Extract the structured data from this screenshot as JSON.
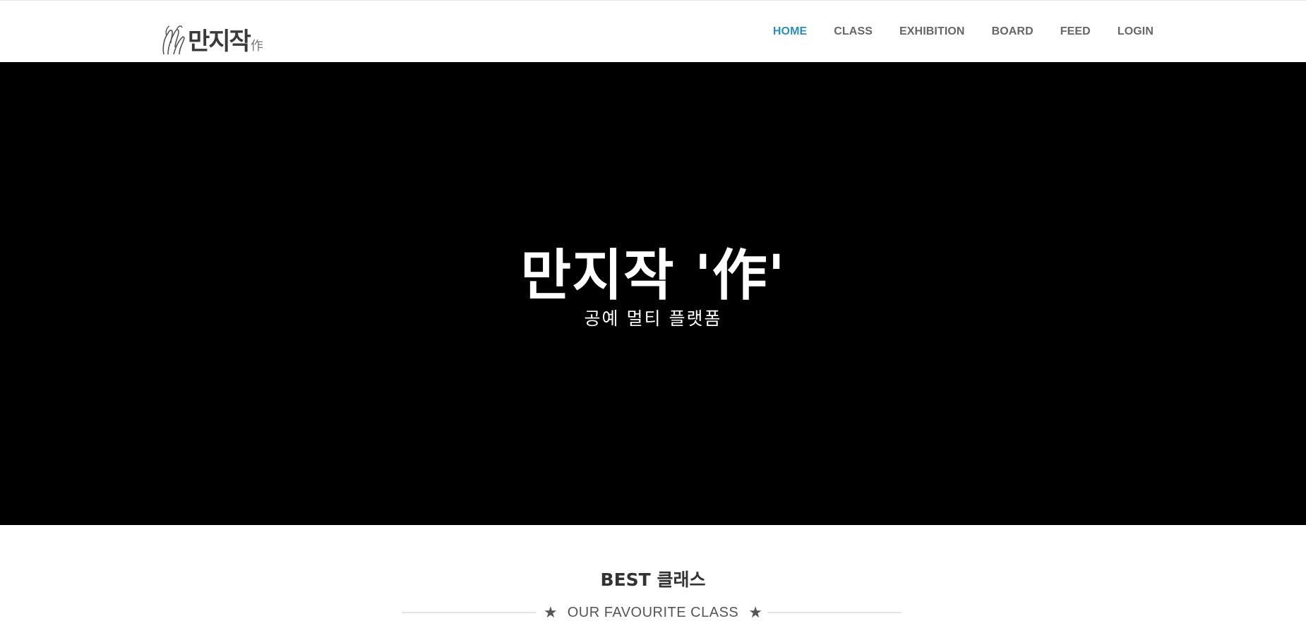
{
  "brand": {
    "logo_text": "만지작",
    "logo_sub": "作",
    "logo_icon": "hands-icon"
  },
  "nav": {
    "items": [
      {
        "label": "HOME",
        "active": true
      },
      {
        "label": "CLASS",
        "active": false
      },
      {
        "label": "EXHIBITION",
        "active": false
      },
      {
        "label": "BOARD",
        "active": false
      },
      {
        "label": "FEED",
        "active": false
      },
      {
        "label": "LOGIN",
        "active": false
      }
    ],
    "active_color": "#2b8fbd",
    "text_color": "#666666"
  },
  "hero": {
    "title": "만지작 '作'",
    "subtitle": "공예 멀티 플랫폼",
    "background": "#000000"
  },
  "best_section": {
    "title": "BEST 클래스",
    "subtitle": "OUR FAVOURITE CLASS",
    "divider_icon": "star-icon"
  }
}
